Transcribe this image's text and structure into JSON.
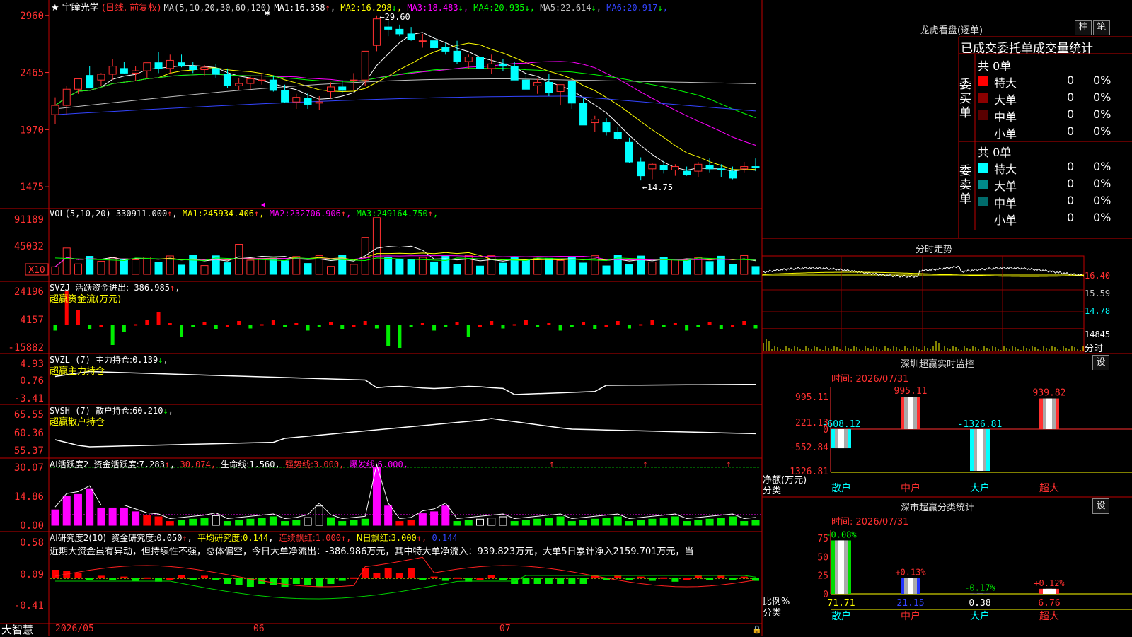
{
  "app": {
    "stock_name": "宇瞳光学",
    "period_note": "(日线, 前复权)",
    "brand": "大智慧"
  },
  "main_chart": {
    "ma_prefix": "MA(5,10,20,30,60,120)",
    "ma_items": [
      {
        "label": "MA1:",
        "value": "16.358",
        "arrow": "↑",
        "color": "#ffffff"
      },
      {
        "label": "MA2:",
        "value": "16.298",
        "arrow": "↓",
        "color": "#ffff00"
      },
      {
        "label": "MA3:",
        "value": "18.483",
        "arrow": "↓",
        "color": "#ff00ff"
      },
      {
        "label": "MA4:",
        "value": "20.935",
        "arrow": "↓",
        "color": "#00ff00"
      },
      {
        "label": "MA5:",
        "value": "22.614",
        "arrow": "↓",
        "color": "#c0c0c0"
      },
      {
        "label": "MA6:",
        "value": "20.917",
        "arrow": "↓",
        "color": "#3344ff"
      }
    ],
    "y_ticks": [
      "2960",
      "2465",
      "1970",
      "1475"
    ],
    "high_label": "←29.60",
    "low_label": "←14.75",
    "candles": [
      [
        21.0,
        22.5,
        20.2,
        21.8
      ],
      [
        21.8,
        23.5,
        21.0,
        23.2
      ],
      [
        23.2,
        24.0,
        22.8,
        24.1
      ],
      [
        24.4,
        25.2,
        23.4,
        23.3
      ],
      [
        24.0,
        24.6,
        23.5,
        24.5
      ],
      [
        24.5,
        25.8,
        24.0,
        25.2
      ],
      [
        25.0,
        25.6,
        24.5,
        24.6
      ],
      [
        24.6,
        25.2,
        23.9,
        24.8
      ],
      [
        24.8,
        25.5,
        24.2,
        25.5
      ],
      [
        25.5,
        26.4,
        24.6,
        25.0
      ],
      [
        25.0,
        26.2,
        24.5,
        25.7
      ],
      [
        25.5,
        26.2,
        25.1,
        25.2
      ],
      [
        25.2,
        25.6,
        24.6,
        24.9
      ],
      [
        24.9,
        25.3,
        24.4,
        25.1
      ],
      [
        25.0,
        25.4,
        24.2,
        24.5
      ],
      [
        24.5,
        25.0,
        23.3,
        23.5
      ],
      [
        23.5,
        24.2,
        23.1,
        23.7
      ],
      [
        23.7,
        24.3,
        23.2,
        24.1
      ],
      [
        24.0,
        24.6,
        23.6,
        24.0
      ],
      [
        24.0,
        24.4,
        23.0,
        23.1
      ],
      [
        23.1,
        23.6,
        22.0,
        22.1
      ],
      [
        22.1,
        22.8,
        21.5,
        22.5
      ],
      [
        22.4,
        22.9,
        21.5,
        21.9
      ],
      [
        22.0,
        22.6,
        21.4,
        22.1
      ],
      [
        23.0,
        23.8,
        22.4,
        23.4
      ],
      [
        23.4,
        24.0,
        22.9,
        23.1
      ],
      [
        24.0,
        24.6,
        23.1,
        24.0
      ],
      [
        24.0,
        26.5,
        23.5,
        26.5
      ],
      [
        27.0,
        29.6,
        26.5,
        29.3
      ],
      [
        28.6,
        29.2,
        27.8,
        28.4
      ],
      [
        28.4,
        28.8,
        27.8,
        28.0
      ],
      [
        28.0,
        28.6,
        27.4,
        27.5
      ],
      [
        27.4,
        28.0,
        26.8,
        27.4
      ],
      [
        27.4,
        27.8,
        26.6,
        26.8
      ],
      [
        26.8,
        27.2,
        26.2,
        26.5
      ],
      [
        26.5,
        27.4,
        25.4,
        25.6
      ],
      [
        25.6,
        26.2,
        25.0,
        26.0
      ],
      [
        26.0,
        27.0,
        25.5,
        25.0
      ],
      [
        25.0,
        26.2,
        24.5,
        25.4
      ],
      [
        25.4,
        25.8,
        24.8,
        25.2
      ],
      [
        25.2,
        25.6,
        24.2,
        24.0
      ],
      [
        24.0,
        24.6,
        23.4,
        23.2
      ],
      [
        23.5,
        24.1,
        22.8,
        23.8
      ],
      [
        23.8,
        24.5,
        22.6,
        22.9
      ],
      [
        23.0,
        23.5,
        21.8,
        23.6
      ],
      [
        23.9,
        24.2,
        21.5,
        22.0
      ],
      [
        22.0,
        22.4,
        20.8,
        20.1
      ],
      [
        20.3,
        20.9,
        19.5,
        20.6
      ],
      [
        20.3,
        20.7,
        19.2,
        19.5
      ],
      [
        19.5,
        19.9,
        18.8,
        18.9
      ],
      [
        18.6,
        19.0,
        16.8,
        16.9
      ],
      [
        16.9,
        17.3,
        15.3,
        15.7
      ],
      [
        16.3,
        16.8,
        15.4,
        16.7
      ],
      [
        16.6,
        17.0,
        15.9,
        16.2
      ],
      [
        16.2,
        16.7,
        15.7,
        16.5
      ],
      [
        16.1,
        16.5,
        15.7,
        15.8
      ],
      [
        16.1,
        16.9,
        15.6,
        16.7
      ],
      [
        16.6,
        17.2,
        16.0,
        16.3
      ],
      [
        16.3,
        16.7,
        15.6,
        16.2
      ],
      [
        16.1,
        16.5,
        15.4,
        15.5
      ],
      [
        16.3,
        16.9,
        16.0,
        16.5
      ],
      [
        16.5,
        17.2,
        16.1,
        16.4
      ]
    ]
  },
  "vol_panel": {
    "prefix": "VOL(5,10,20)",
    "value": "330911.000",
    "value_arrow": "↑",
    "items": [
      {
        "label": "MA1:",
        "value": "245934.406",
        "arrow": "↑",
        "color": "#ffff00"
      },
      {
        "label": "MA2:",
        "value": "232706.906",
        "arrow": "↑",
        "color": "#ff00ff"
      },
      {
        "label": "MA3:",
        "value": "249164.750",
        "arrow": "↑",
        "color": "#00ff00"
      }
    ],
    "y_ticks": [
      "91189",
      "45032"
    ],
    "unit_box": "X10"
  },
  "svzj_panel": {
    "line1_prefix": "SVZJ",
    "line1_label": "活跃资金进出:",
    "line1_value": "-386.985",
    "line1_arrow": "↑",
    "line2": "超赢资金流(万元)",
    "y_ticks": [
      "24196",
      "4157",
      "-15882"
    ]
  },
  "svzl_panel": {
    "prefix": "SVZL (7)",
    "label": "主力持仓:",
    "value": "0.139",
    "arrow": "↓",
    "line2": "超赢主力持仓",
    "y_ticks": [
      "4.93",
      "0.76",
      "-3.41"
    ]
  },
  "svsh_panel": {
    "prefix": "SVSH (7)",
    "label": "散户持仓:",
    "value": "60.210",
    "arrow": "↓",
    "line2": "超赢散户持仓",
    "y_ticks": [
      "65.55",
      "60.36",
      "55.37"
    ]
  },
  "ai_active_panel": {
    "prefix": "AI活跃度2",
    "label": "资金活跃度:",
    "value": "7.283",
    "arrow": "↑",
    "extra1": "30.074,",
    "life_label": "生命线:",
    "life_value": "1.560,",
    "strong_label": "强势线:",
    "strong_value": "3.000,",
    "burst_label": "爆发线:",
    "burst_value": "6.000,",
    "y_ticks": [
      "30.07",
      "14.86",
      "0.00"
    ]
  },
  "ai_research_panel": {
    "prefix": "AI研究度2(10)",
    "label": "资金研究度:",
    "value": "0.050",
    "arrow": "↑",
    "avg_label": "平均研究度:",
    "avg_value": "0.144",
    "red_label": "连续飘红:",
    "red_value": "1.000",
    "n_label": "N日飘红:",
    "n_value": "3.000",
    "last_value": "0.144",
    "y_ticks": [
      "0.58",
      "0.09",
      "-0.41"
    ],
    "comment": "近期大资金虽有异动，但持续性不强，总体偏空，今日大单净流出：-386.986万元，其中特大单净流入：939.823万元，大单5日累计净入2159.701万元，当"
  },
  "x_axis": {
    "labels": [
      "2026/05",
      "06",
      "07"
    ]
  },
  "dragon_panel": {
    "title": "龙虎看盘(逐单)",
    "btn_bar": "柱",
    "btn_order": "笔",
    "subtitle": "已成交委托单成交量统计",
    "buy_label": "委买单",
    "sell_label": "委卖单",
    "buy_total": "共 0单",
    "sell_total": "共 0单",
    "buy_rows": [
      {
        "name": "特大",
        "count": "0",
        "pct": "0%",
        "color": "#ff0000"
      },
      {
        "name": "大单",
        "count": "0",
        "pct": "0%",
        "color": "#8b0000"
      },
      {
        "name": "中单",
        "count": "0",
        "pct": "0%",
        "color": "#5a0000"
      },
      {
        "name": "小单",
        "count": "0",
        "pct": "0%",
        "color": ""
      }
    ],
    "sell_rows": [
      {
        "name": "特大",
        "count": "0",
        "pct": "0%",
        "color": "#00ffff"
      },
      {
        "name": "大单",
        "count": "0",
        "pct": "0%",
        "color": "#008b8b"
      },
      {
        "name": "中单",
        "count": "0",
        "pct": "0%",
        "color": "#006b6b"
      },
      {
        "name": "小单",
        "count": "0",
        "pct": "0%",
        "color": ""
      }
    ]
  },
  "intraday_panel": {
    "title": "分时走势",
    "price_ticks": [
      "16.40",
      "15.59",
      "14.78"
    ],
    "vol_tick": "14845",
    "vol_unit": "分时"
  },
  "realtime_panel": {
    "title": "深圳超赢实时监控",
    "btn": "设",
    "time": "时间: 2026/07/31",
    "y_ticks": [
      "995.11",
      "221.13",
      "0",
      "-552.84",
      "-1326.81"
    ],
    "y_unit": "净额(万元)",
    "x_caption": "分类",
    "categories": [
      "散户",
      "中户",
      "大户",
      "超大"
    ],
    "values": [
      -608.12,
      995.11,
      -1326.81,
      939.82
    ],
    "value_labels": [
      "-608.12",
      "995.11",
      "-1326.81",
      "939.82"
    ],
    "label_colors": [
      "#00ffff",
      "#ff3030",
      "#00ffff",
      "#ff3030"
    ]
  },
  "classify_panel": {
    "title": "深市超赢分类统计",
    "btn": "设",
    "time": "时间: 2026/07/31",
    "y_ticks": [
      "75",
      "50",
      "25",
      "0"
    ],
    "y_unit": "比例%",
    "x_caption": "分类",
    "categories": [
      "散户",
      "中户",
      "大户",
      "超大"
    ],
    "values": [
      71.71,
      21.15,
      0.38,
      6.76
    ],
    "value_labels": [
      "71.71",
      "21.15",
      "0.38",
      "6.76"
    ],
    "change_labels": [
      "-0.08%",
      "+0.13%",
      "-0.17%",
      "+0.12%"
    ],
    "change_colors": [
      "#00ff00",
      "#ff3030",
      "#00ff00",
      "#ff3030"
    ],
    "bar_colors": [
      "#00dd00",
      "#2233ff",
      "#cccccc",
      "#ff3030"
    ]
  }
}
